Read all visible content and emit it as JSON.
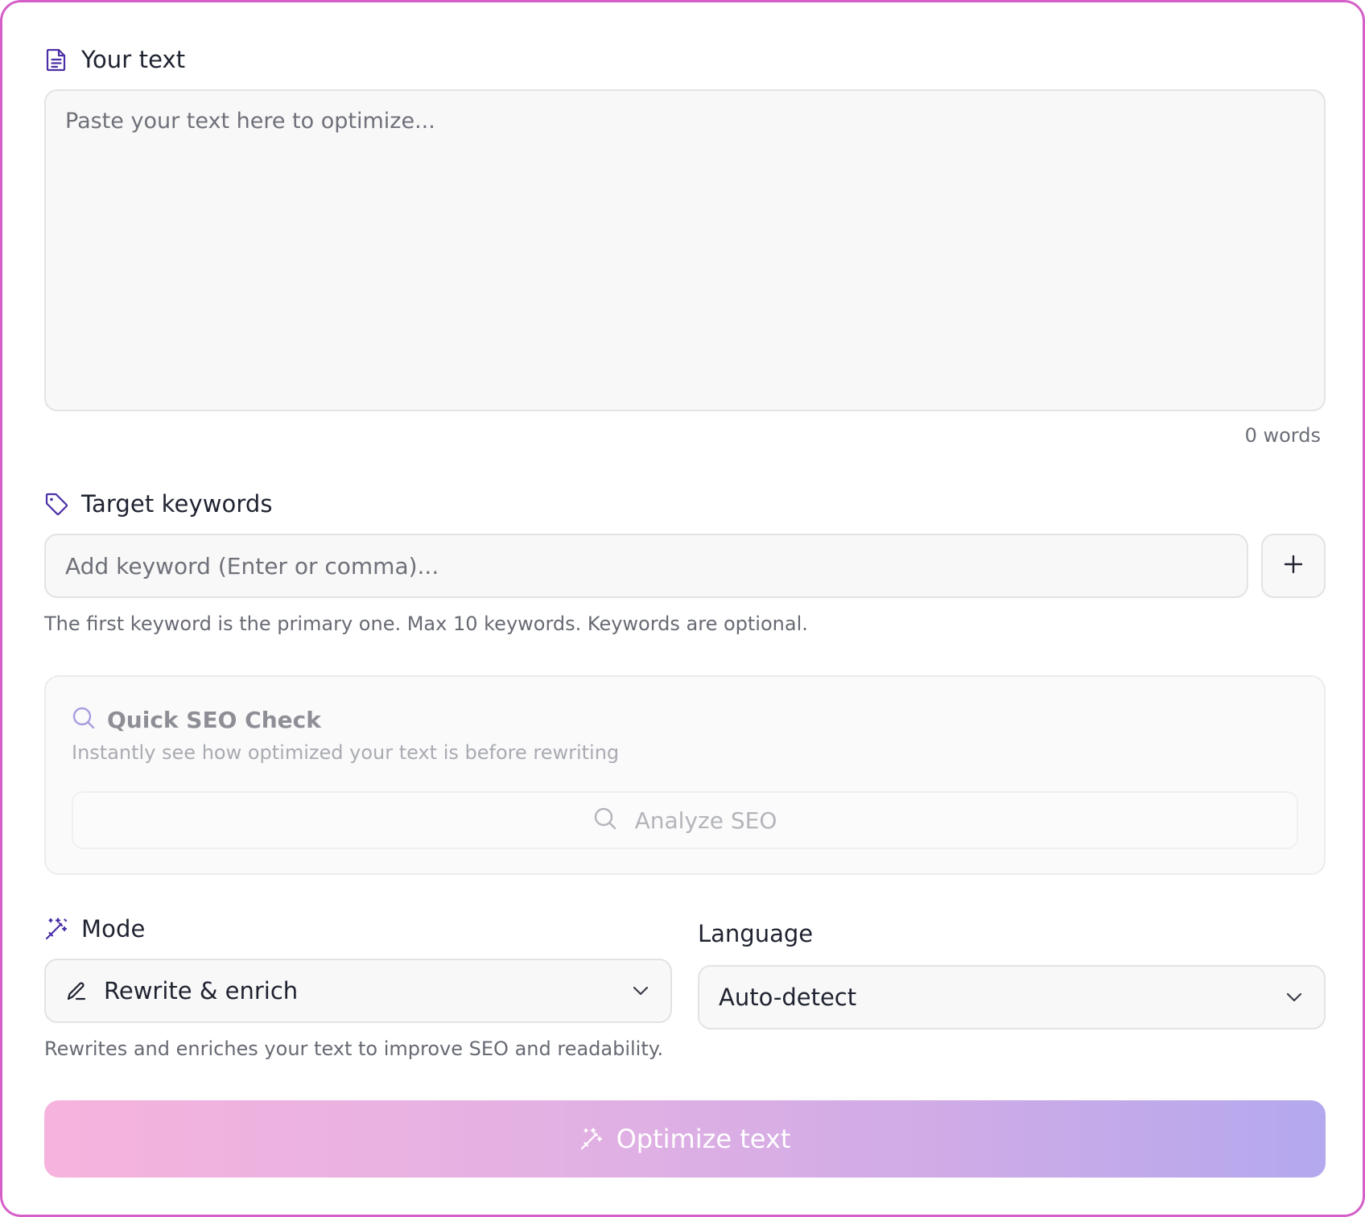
{
  "text_section": {
    "label": "Your text",
    "icon": "document-icon",
    "placeholder": "Paste your text here to optimize...",
    "value": "",
    "word_count": "0 words"
  },
  "keywords_section": {
    "label": "Target keywords",
    "icon": "tag-icon",
    "placeholder": "Add keyword (Enter or comma)...",
    "add_icon": "plus-icon",
    "hint": "The first keyword is the primary one. Max 10 keywords. Keywords are optional."
  },
  "seo_check": {
    "title": "Quick SEO Check",
    "subtitle": "Instantly see how optimized your text is before rewriting",
    "button_label": "Analyze SEO",
    "icon": "search-icon"
  },
  "mode": {
    "label": "Mode",
    "icon": "magic-wand-icon",
    "selected": "Rewrite & enrich",
    "selected_icon": "pen-icon",
    "description": "Rewrites and enriches your text to improve SEO and readability."
  },
  "language": {
    "label": "Language",
    "selected": "Auto-detect"
  },
  "optimize_button": {
    "label": "Optimize text",
    "icon": "magic-wand-icon"
  },
  "colors": {
    "accent": "#4b2fa6",
    "border": "#d45fc8",
    "button_gradient_start": "#f6b3dd",
    "button_gradient_end": "#b4a8ee"
  }
}
